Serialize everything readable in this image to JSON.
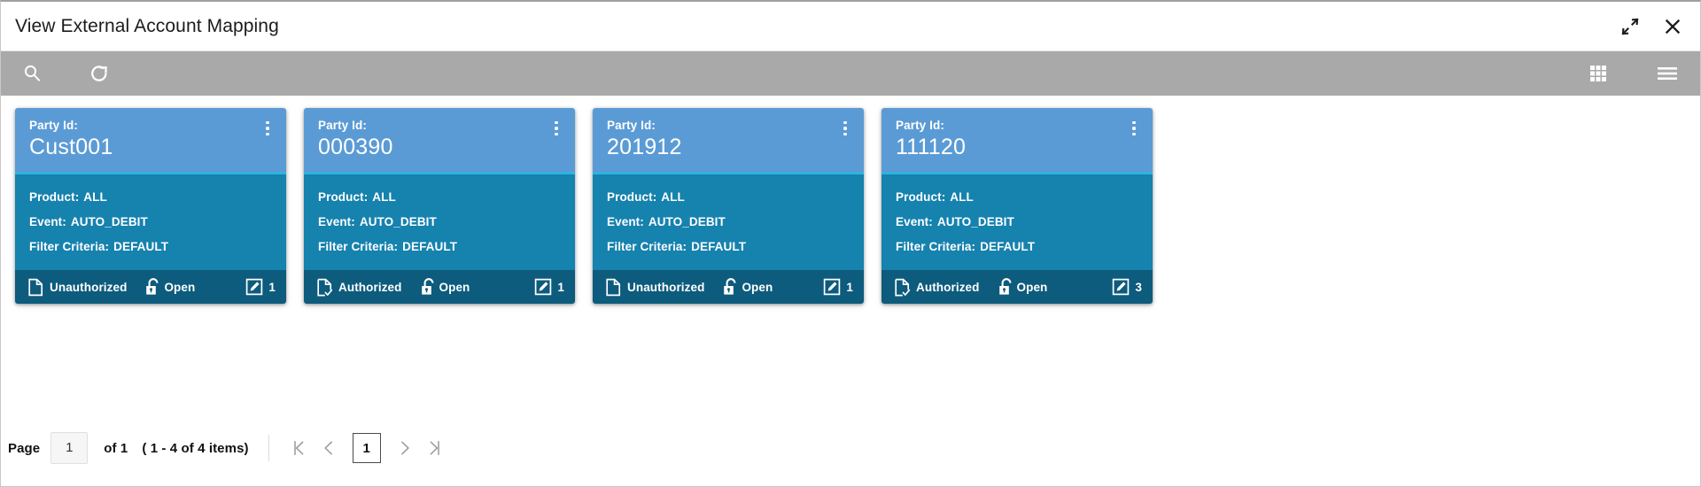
{
  "window": {
    "title": "View External Account Mapping",
    "restore_icon": "restore-down-icon",
    "close_icon": "close-icon"
  },
  "toolbar": {
    "search_icon": "search-icon",
    "refresh_icon": "refresh-icon",
    "grid_view_icon": "grid-view-icon",
    "list_view_icon": "list-view-icon"
  },
  "colors": {
    "card_header": "#5b9bd5",
    "card_accent": "#2fb3e0",
    "card_body": "#1682ae",
    "card_footer": "#0d5b7d",
    "toolbar_bg": "#a9a9a9",
    "title_bg": "#ffffff"
  },
  "card_labels": {
    "party_id": "Party Id:",
    "product": "Product:",
    "event": "Event:",
    "filter_criteria": "Filter Criteria:",
    "menu_icon": "kebab-menu-icon",
    "lock_icon": "unlocked-padlock-icon",
    "edit_icon": "edit-square-icon",
    "authorized_icon": "document-check-icon",
    "unauthorized_icon": "document-icon"
  },
  "cards": [
    {
      "party_id": "Cust001",
      "product": "ALL",
      "event": "AUTO_DEBIT",
      "filter_criteria": "DEFAULT",
      "auth_status": "Unauthorized",
      "auth_icon": "document-icon",
      "lock_status": "Open",
      "edit_count": "1"
    },
    {
      "party_id": "000390",
      "product": "ALL",
      "event": "AUTO_DEBIT",
      "filter_criteria": "DEFAULT",
      "auth_status": "Authorized",
      "auth_icon": "document-check-icon",
      "lock_status": "Open",
      "edit_count": "1"
    },
    {
      "party_id": "201912",
      "product": "ALL",
      "event": "AUTO_DEBIT",
      "filter_criteria": "DEFAULT",
      "auth_status": "Unauthorized",
      "auth_icon": "document-icon",
      "lock_status": "Open",
      "edit_count": "1"
    },
    {
      "party_id": "111120",
      "product": "ALL",
      "event": "AUTO_DEBIT",
      "filter_criteria": "DEFAULT",
      "auth_status": "Authorized",
      "auth_icon": "document-check-icon",
      "lock_status": "Open",
      "edit_count": "3"
    }
  ],
  "pagination": {
    "page_label": "Page",
    "page_value": "1",
    "of_text": "of 1",
    "items_text": "( 1 - 4 of 4 items)",
    "current_page": "1",
    "first_icon": "first-page-icon",
    "prev_icon": "previous-page-icon",
    "next_icon": "next-page-icon",
    "last_icon": "last-page-icon"
  }
}
